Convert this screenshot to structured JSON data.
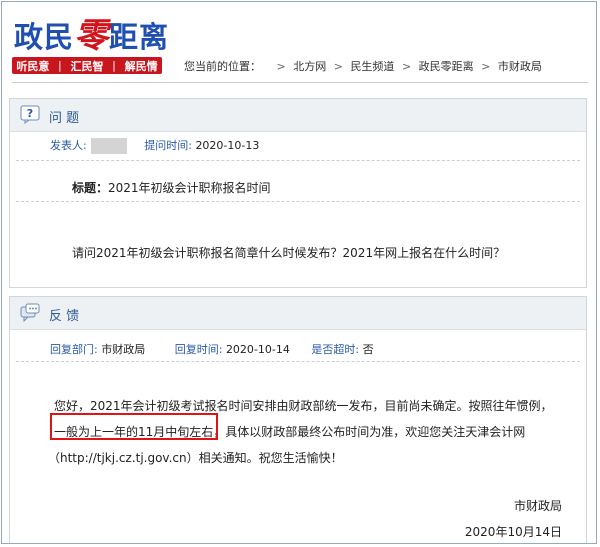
{
  "header": {
    "logo_a": "政民",
    "logo_b": "零",
    "logo_c": "距离",
    "nav": [
      "听民意",
      "汇民智",
      "解民情"
    ],
    "breadcrumb_label": "您当前的位置：",
    "breadcrumb": [
      "北方网",
      "民生频道",
      "政民零距离",
      "市财政局"
    ]
  },
  "question": {
    "title": "问 题",
    "poster_label": "发表人:",
    "time_label": "提问时间:",
    "time": "2020-10-13",
    "subject_label": "标题：",
    "subject": "2021年初级会计职称报名时间",
    "text": "请问2021年初级会计职称报名简章什么时候发布？2021年网上报名在什么时间？"
  },
  "answer": {
    "title": "反 馈",
    "dept_label": "回复部门:",
    "dept": "市财政局",
    "time_label": "回复时间:",
    "time": "2020-10-14",
    "overdue_label": "是否超时:",
    "overdue": "否",
    "line1": "您好，2021年会计初级考试报名时间安排由财政部统一发布，目前尚未确定。按照往年惯例，",
    "line2_hl": "一般为上一年的11月中旬左右，",
    "line2_rest": "具体以财政部最终公布时间为准，欢迎您关注天津会计网",
    "line3": "（http://tjkj.cz.tj.gov.cn）相关通知。祝您生活愉快！",
    "sign": "市财政局",
    "date": "2020年10月14日"
  },
  "colors": {
    "brand_blue": "#1f4fb0",
    "brand_red": "#d2141c",
    "highlight": "#e01414"
  }
}
